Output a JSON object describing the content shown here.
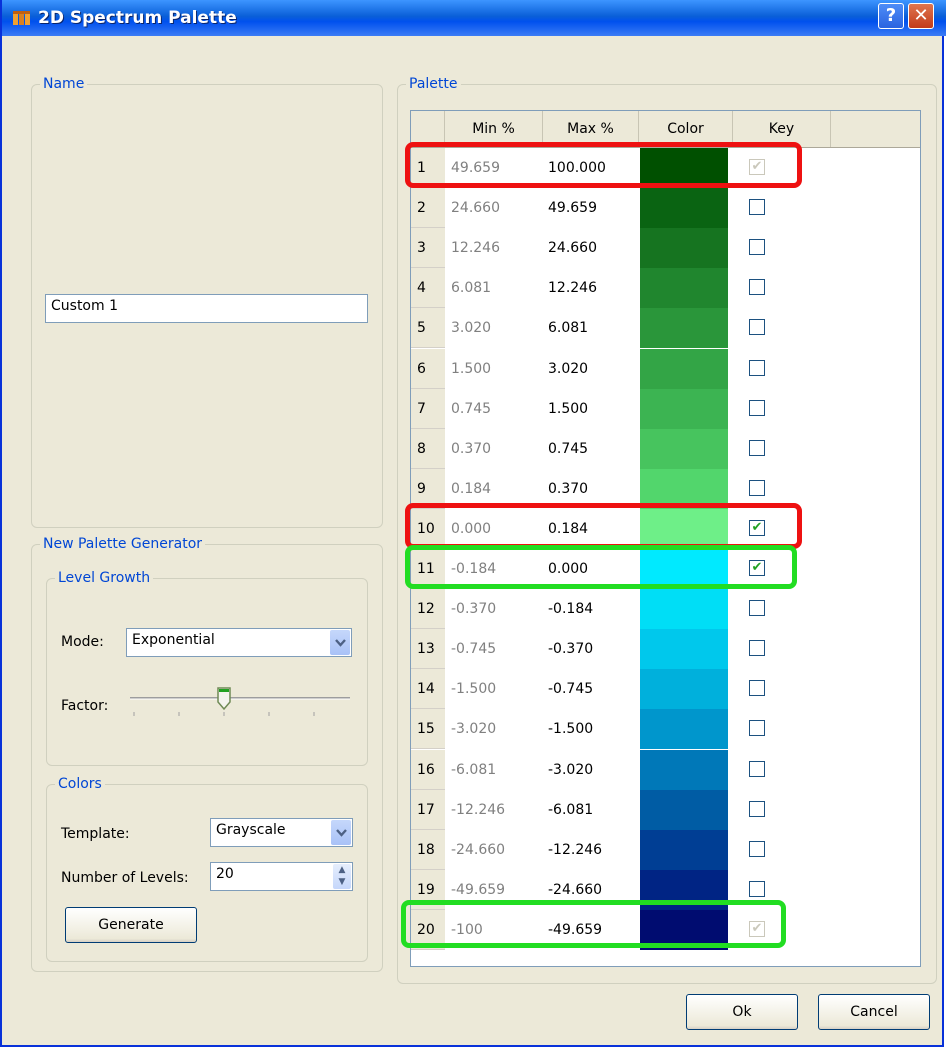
{
  "window": {
    "title": "2D Spectrum Palette",
    "help_glyph": "?",
    "close_glyph": "✕"
  },
  "name_group": {
    "legend": "Name",
    "value": "Custom 1"
  },
  "generator_group": {
    "legend": "New Palette Generator",
    "level_growth": {
      "legend": "Level Growth",
      "mode_label": "Mode:",
      "mode_value": "Exponential",
      "factor_label": "Factor:"
    },
    "colors": {
      "legend": "Colors",
      "template_label": "Template:",
      "template_value": "Grayscale",
      "levels_label": "Number of Levels:",
      "levels_value": "20",
      "generate_label": "Generate"
    }
  },
  "palette_group": {
    "legend": "Palette",
    "columns": [
      "Min %",
      "Max %",
      "Color",
      "Key"
    ],
    "rows": [
      {
        "num": "1",
        "min": "49.659",
        "max": "100.000",
        "color": "#005000",
        "key": true,
        "key_disabled": true
      },
      {
        "num": "2",
        "min": "24.660",
        "max": "49.659",
        "color": "#0a6412",
        "key": false
      },
      {
        "num": "3",
        "min": "12.246",
        "max": "24.660",
        "color": "#167420",
        "key": false
      },
      {
        "num": "4",
        "min": "6.081",
        "max": "12.246",
        "color": "#20862e",
        "key": false
      },
      {
        "num": "5",
        "min": "3.020",
        "max": "6.081",
        "color": "#2a963a",
        "key": false
      },
      {
        "num": "6",
        "min": "1.500",
        "max": "3.020",
        "color": "#33a546",
        "key": false
      },
      {
        "num": "7",
        "min": "0.745",
        "max": "1.500",
        "color": "#3cb452",
        "key": false
      },
      {
        "num": "8",
        "min": "0.370",
        "max": "0.745",
        "color": "#47c45e",
        "key": false
      },
      {
        "num": "9",
        "min": "0.184",
        "max": "0.370",
        "color": "#52d66c",
        "key": false
      },
      {
        "num": "10",
        "min": "0.000",
        "max": "0.184",
        "color": "#6eef88",
        "key": true
      },
      {
        "num": "11",
        "min": "-0.184",
        "max": "0.000",
        "color": "#00eaff",
        "key": true
      },
      {
        "num": "12",
        "min": "-0.370",
        "max": "-0.184",
        "color": "#00def6",
        "key": false
      },
      {
        "num": "13",
        "min": "-0.745",
        "max": "-0.370",
        "color": "#00c8ec",
        "key": false
      },
      {
        "num": "14",
        "min": "-1.500",
        "max": "-0.745",
        "color": "#00b0dc",
        "key": false
      },
      {
        "num": "15",
        "min": "-3.020",
        "max": "-1.500",
        "color": "#0096cc",
        "key": false
      },
      {
        "num": "16",
        "min": "-6.081",
        "max": "-3.020",
        "color": "#0078b8",
        "key": false
      },
      {
        "num": "17",
        "min": "-12.246",
        "max": "-6.081",
        "color": "#005ca4",
        "key": false
      },
      {
        "num": "18",
        "min": "-24.660",
        "max": "-12.246",
        "color": "#003e94",
        "key": false
      },
      {
        "num": "19",
        "min": "-49.659",
        "max": "-24.660",
        "color": "#002484",
        "key": false
      },
      {
        "num": "20",
        "min": "-100",
        "max": "-49.659",
        "color": "#000c70",
        "key": true,
        "key_disabled": true
      }
    ]
  },
  "buttons": {
    "ok": "Ok",
    "cancel": "Cancel"
  },
  "colors": {
    "title_text": "#ffffff",
    "legend": "#0046d5",
    "highlight_red": "#ee1111",
    "highlight_green": "#22dd22"
  }
}
